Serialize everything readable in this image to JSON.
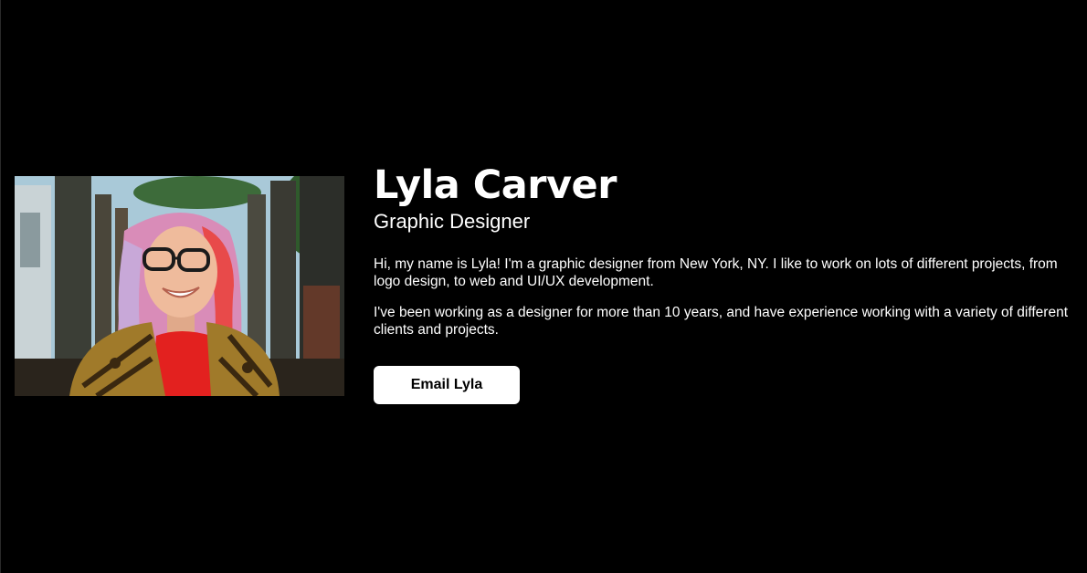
{
  "profile": {
    "photo_alt": "Lyla Carver",
    "name": "Lyla Carver",
    "role": "Graphic Designer",
    "bio": [
      "Hi, my name is Lyla! I'm a graphic designer from New York, NY. I like to work on lots of different projects, from logo design, to web and UI/UX development.",
      "I've been working as a designer for more than 10 years, and have experience working with a variety of different clients and projects."
    ],
    "email_button_label": "Email Lyla"
  },
  "colors": {
    "background": "#000000",
    "text": "#ffffff",
    "button_bg": "#ffffff",
    "button_text": "#000000"
  }
}
